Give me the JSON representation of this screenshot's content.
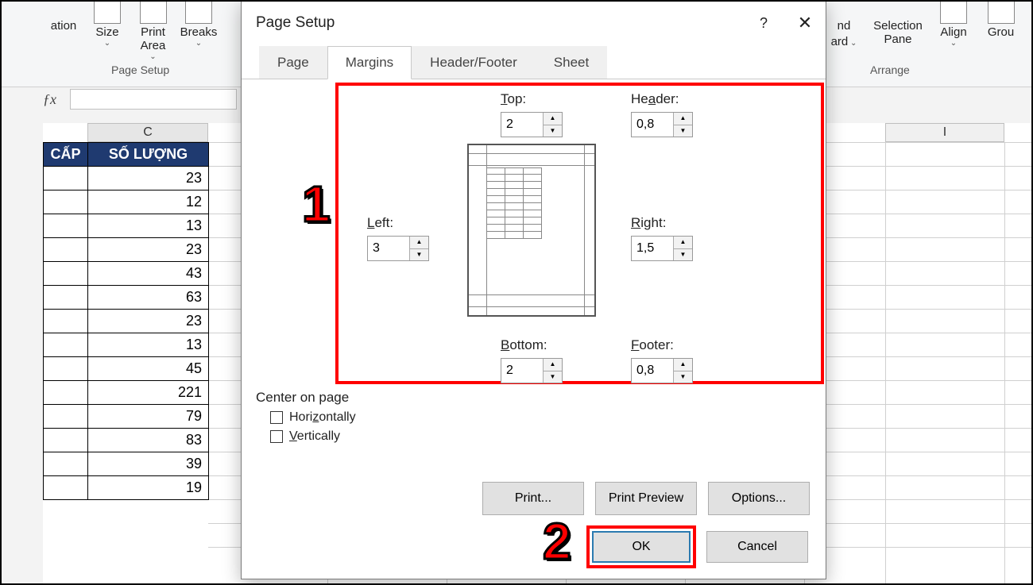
{
  "ribbon": {
    "items": [
      {
        "label": "ation"
      },
      {
        "label": "Size"
      },
      {
        "label": "Print\nArea"
      },
      {
        "label": "Breaks"
      },
      {
        "label": "nd"
      },
      {
        "label": "ard"
      },
      {
        "label": "Selection\nPane"
      },
      {
        "label": "Align"
      },
      {
        "label": "Grou"
      }
    ],
    "groups": {
      "page_setup": "Page Setup",
      "arrange": "Arrange"
    }
  },
  "sheet": {
    "col_c": "C",
    "col_i": "I",
    "col_b_header": "CẤP",
    "col_c_header": "SỐ LƯỢNG",
    "rows": [
      23,
      12,
      13,
      23,
      43,
      63,
      23,
      13,
      45,
      221,
      79,
      83,
      39,
      19
    ]
  },
  "dialog": {
    "title": "Page Setup",
    "tabs": {
      "page": "Page",
      "margins": "Margins",
      "hf": "Header/Footer",
      "sheet": "Sheet"
    },
    "margins": {
      "top_label": "Top:",
      "top": "2",
      "header_label": "Header:",
      "header": "0,8",
      "left_label": "Left:",
      "left": "3",
      "right_label": "Right:",
      "right": "1,5",
      "bottom_label": "Bottom:",
      "bottom": "2",
      "footer_label": "Footer:",
      "footer": "0,8"
    },
    "center": {
      "title": "Center on page",
      "horiz": "Horizontally",
      "vert": "Vertically"
    },
    "buttons": {
      "print": "Print...",
      "preview": "Print Preview",
      "options": "Options...",
      "ok": "OK",
      "cancel": "Cancel"
    }
  },
  "annotations": {
    "step1": "1",
    "step2": "2"
  }
}
